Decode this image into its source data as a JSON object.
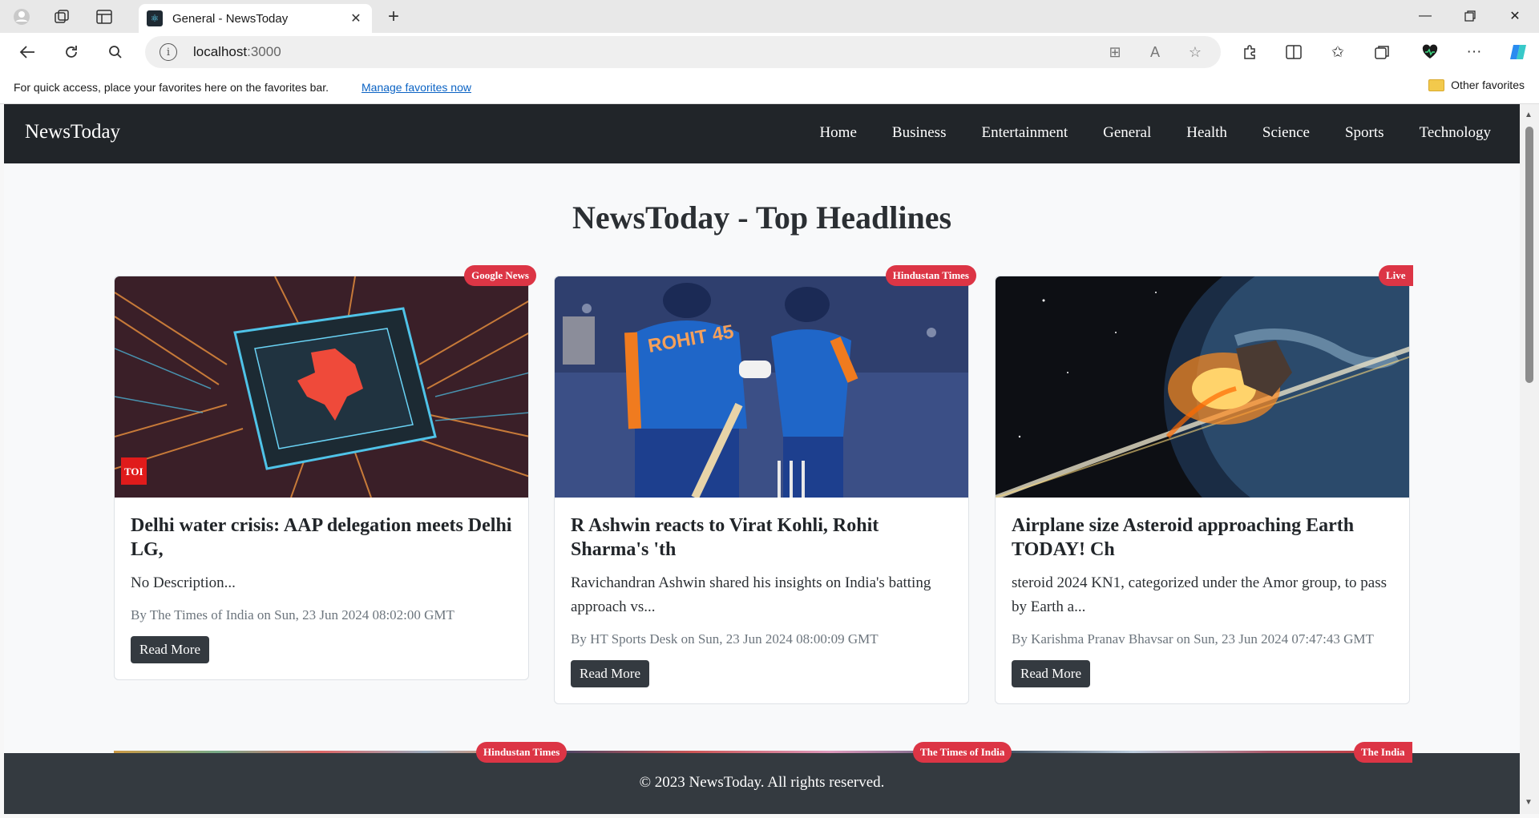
{
  "browser": {
    "tab_title": "General - NewsToday",
    "url_host": "localhost",
    "url_port": ":3000",
    "favorites_prompt": "For quick access, place your favorites here on the favorites bar.",
    "favorites_link": "Manage favorites now",
    "other_favorites": "Other favorites"
  },
  "site": {
    "brand": "NewsToday",
    "nav": [
      "Home",
      "Business",
      "Entertainment",
      "General",
      "Health",
      "Science",
      "Sports",
      "Technology"
    ],
    "page_title": "NewsToday - Top Headlines",
    "footer": "© 2023 NewsToday. All rights reserved."
  },
  "articles": [
    {
      "source": "Google News",
      "title": "Delhi water crisis: AAP delegation meets Delhi LG,",
      "description": "No Description...",
      "meta": "By The Times of India on Sun, 23 Jun 2024 08:02:00 GMT",
      "button": "Read More",
      "image_overlay": "TOI"
    },
    {
      "source": "Hindustan Times",
      "title": "R Ashwin reacts to Virat Kohli, Rohit Sharma's 'th",
      "description": "Ravichandran Ashwin shared his insights on India's batting approach vs...",
      "meta": "By HT Sports Desk on Sun, 23 Jun 2024 08:00:09 GMT",
      "button": "Read More",
      "image_overlay": "ROHIT 45"
    },
    {
      "source": "Live",
      "title": "Airplane size Asteroid approaching Earth TODAY! Ch",
      "description": "steroid 2024 KN1, categorized under the Amor group, to pass by Earth a...",
      "meta": "By Karishma Pranav Bhavsar on Sun, 23 Jun 2024 07:47:43 GMT",
      "button": "Read More",
      "image_overlay": ""
    }
  ],
  "next_row_sources": [
    "Hindustan Times",
    "The Times of India",
    "The India"
  ]
}
